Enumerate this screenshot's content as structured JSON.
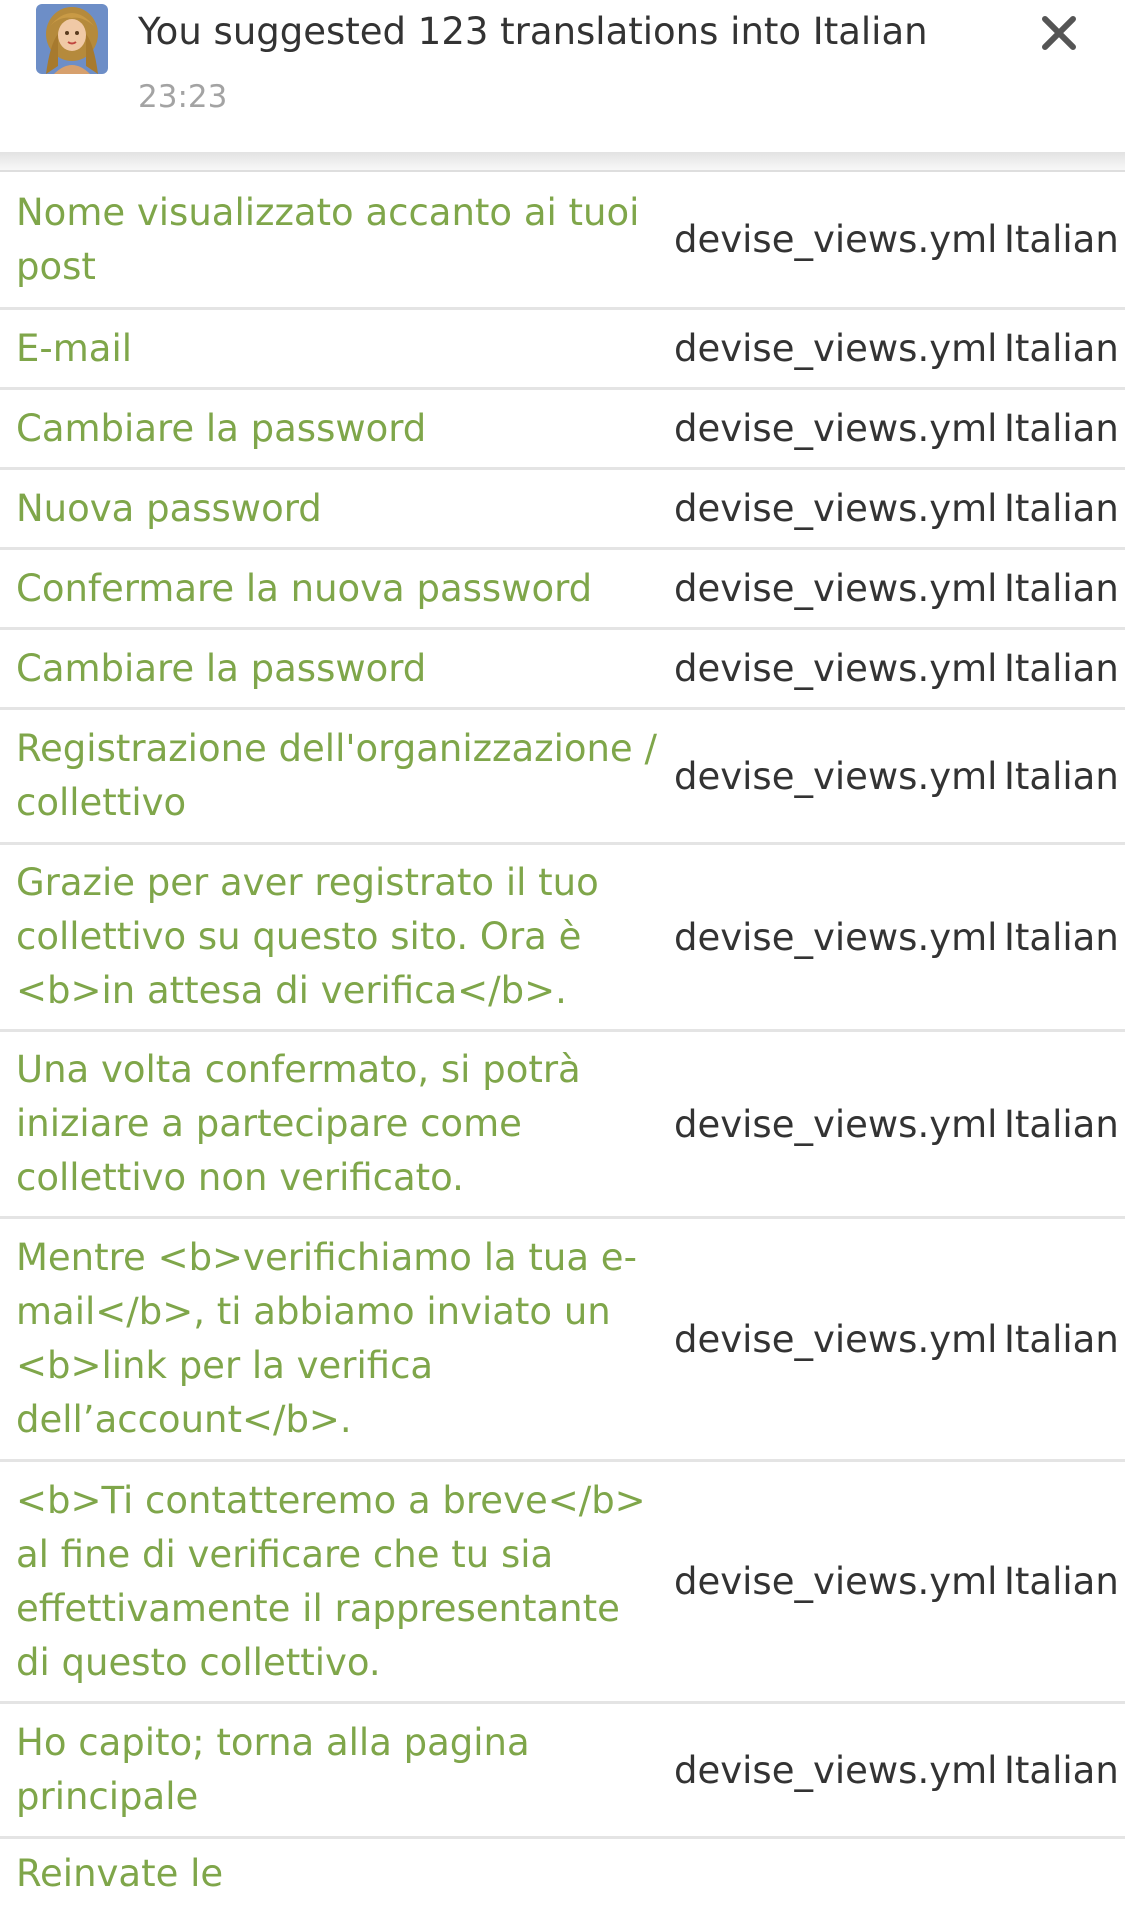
{
  "notification": {
    "title": "You suggested 123 translations into Italian",
    "time": "23:23"
  },
  "rows": [
    {
      "text": "Nome visualizzato accanto ai tuoi post",
      "file": "devise_views.yml",
      "lang": "Italian"
    },
    {
      "text": "E-mail",
      "file": "devise_views.yml",
      "lang": "Italian"
    },
    {
      "text": "Cambiare la password",
      "file": "devise_views.yml",
      "lang": "Italian"
    },
    {
      "text": "Nuova password",
      "file": "devise_views.yml",
      "lang": "Italian"
    },
    {
      "text": "Confermare la nuova password",
      "file": "devise_views.yml",
      "lang": "Italian"
    },
    {
      "text": "Cambiare la password",
      "file": "devise_views.yml",
      "lang": "Italian"
    },
    {
      "text": "Registrazione dell'organizzazione / collettivo",
      "file": "devise_views.yml",
      "lang": "Italian"
    },
    {
      "text": "Grazie per aver registrato il tuo collettivo su questo sito. Ora è <b>in attesa di verifica</b>.",
      "file": "devise_views.yml",
      "lang": "Italian"
    },
    {
      "text": "Una volta confermato, si potrà iniziare a partecipare come collettivo non verificato.",
      "file": "devise_views.yml",
      "lang": "Italian"
    },
    {
      "text": "Mentre <b>verifichiamo la tua e-mail</b>, ti abbiamo inviato un <b>link per la verifica dell’account</b>.",
      "file": "devise_views.yml",
      "lang": "Italian"
    },
    {
      "text": "<b>Ti contatteremo a breve</b> al fine di verificare che tu sia effettivamente il rappresentante di questo collettivo.",
      "file": "devise_views.yml",
      "lang": "Italian"
    },
    {
      "text": "Ho capito; torna alla pagina principale",
      "file": "devise_views.yml",
      "lang": "Italian"
    },
    {
      "text": "Reinvate le",
      "file": "",
      "lang": ""
    }
  ]
}
